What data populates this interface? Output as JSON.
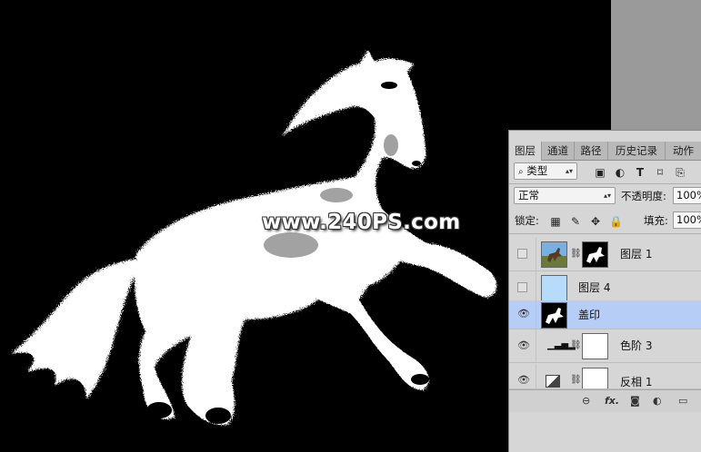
{
  "watermark": "www.240PS.com",
  "layers_panel": {
    "tabs": [
      {
        "label": "图层",
        "active": true
      },
      {
        "label": "通道",
        "active": false
      },
      {
        "label": "路径",
        "active": false
      },
      {
        "label": "历史记录",
        "active": false
      },
      {
        "label": "动作",
        "active": false
      }
    ],
    "filter": {
      "kind_label": "类型",
      "search_icon": "search-icon"
    },
    "blend_mode": "正常",
    "opacity_label": "不透明度:",
    "opacity_value": "100%",
    "lock_label": "锁定:",
    "fill_label": "填充:",
    "fill_value": "100%",
    "layers": [
      {
        "name": "图层 1",
        "visible": false,
        "selected": false,
        "has_mask": true
      },
      {
        "name": "图层 4",
        "visible": false,
        "selected": false,
        "has_mask": false
      },
      {
        "name": "盖印",
        "visible": true,
        "selected": true,
        "has_mask": false
      },
      {
        "name": "色阶 3",
        "visible": true,
        "selected": false,
        "has_mask": true
      },
      {
        "name": "反相 1",
        "visible": true,
        "selected": false,
        "has_mask": true
      }
    ],
    "bottom_icons": [
      "link-icon",
      "fx-icon",
      "mask-icon",
      "adjustment-icon",
      "folder-icon"
    ],
    "fx_label": "fx."
  },
  "colors": {
    "canvas_bg": "#000000",
    "panel_bg": "#d6d6d6",
    "selected_layer": "#b6cdf5",
    "thumb_light_blue": "#b7dcfb"
  }
}
